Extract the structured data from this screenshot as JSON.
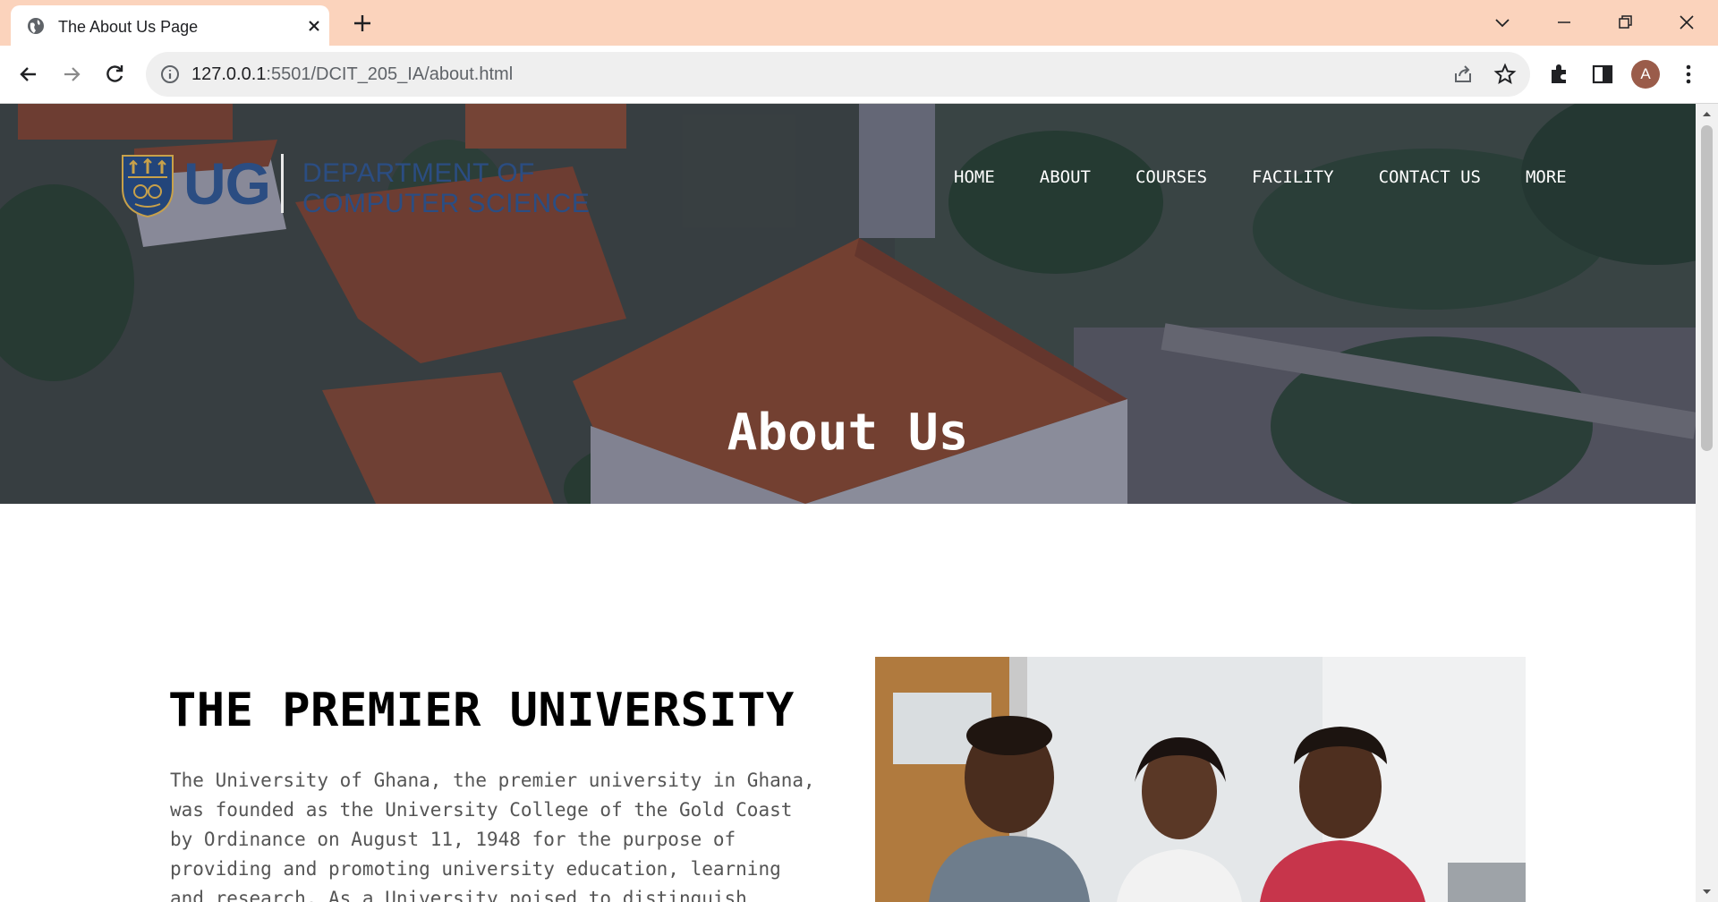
{
  "browser": {
    "tab_title": "The About Us Page",
    "url_host": "127.0.0.1",
    "url_rest": ":5501/DCIT_205_IA/about.html",
    "profile_initial": "A",
    "icons": [
      "globe-icon",
      "close-icon",
      "plus-icon",
      "chevron-down-icon",
      "minimize-icon",
      "restore-icon",
      "window-close-icon",
      "back-icon",
      "forward-icon",
      "reload-icon",
      "info-icon",
      "share-icon",
      "star-icon",
      "puzzle-icon",
      "side-panel-icon",
      "kebab-menu-icon"
    ]
  },
  "site": {
    "logo": {
      "ug": "UG",
      "dept_line1": "DEPARTMENT OF",
      "dept_line2": "COMPUTER SCIENCE"
    },
    "nav": [
      "HOME",
      "ABOUT",
      "COURSES",
      "FACILITY",
      "CONTACT US",
      "MORE"
    ],
    "hero_title": "About Us",
    "section": {
      "heading": "THE PREMIER UNIVERSITY",
      "paragraph": "The University of Ghana, the premier university in Ghana, was founded as the University College of the Gold Coast by Ordinance on August 11, 1948 for the purpose of providing and promoting university education, learning and research. As a University poised to distinguish"
    }
  },
  "colors": {
    "tabstrip": "#fbd3bc",
    "logo_blue": "#2b4d82",
    "roof": "#a4532f"
  }
}
